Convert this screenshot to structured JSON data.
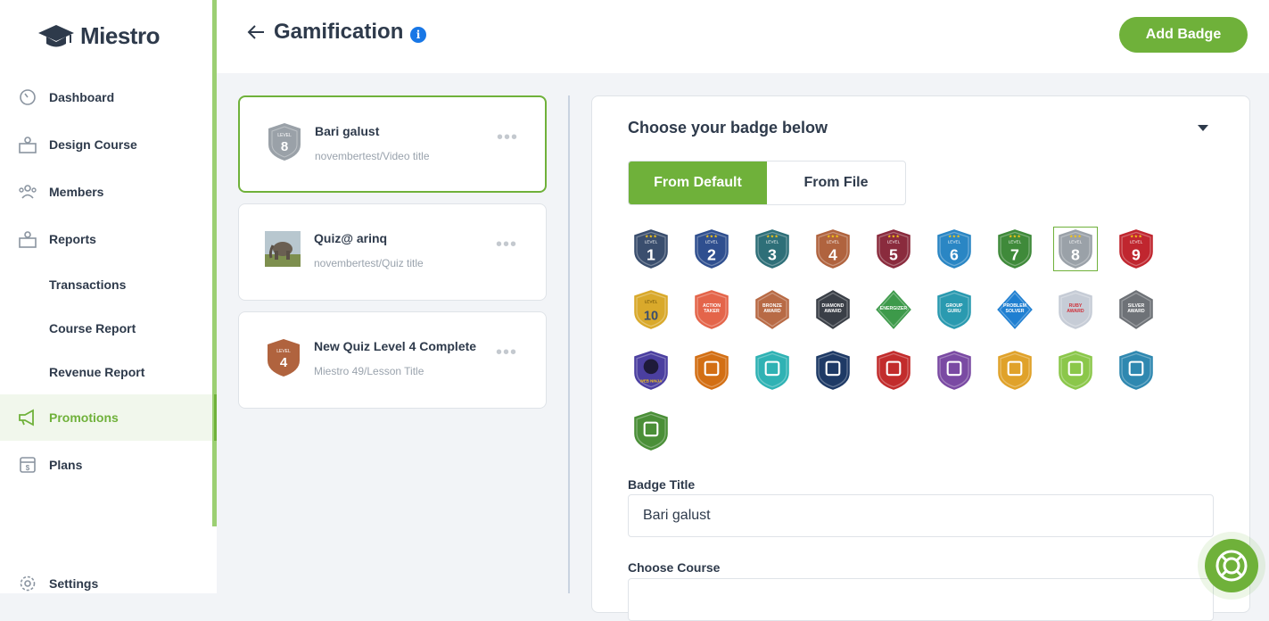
{
  "brand": {
    "name": "Miestro"
  },
  "sidebar": {
    "items": [
      {
        "label": "Dashboard"
      },
      {
        "label": "Design Course"
      },
      {
        "label": "Members"
      },
      {
        "label": "Reports"
      },
      {
        "label": "Transactions"
      },
      {
        "label": "Course Report"
      },
      {
        "label": "Revenue Report"
      },
      {
        "label": "Promotions"
      },
      {
        "label": "Plans"
      },
      {
        "label": "Settings"
      }
    ]
  },
  "header": {
    "title": "Gamification",
    "info_icon": "i",
    "add_button": "Add Badge"
  },
  "badge_list": [
    {
      "title": "Bari galust",
      "subtitle": "novembertest/Video title",
      "level": "8",
      "level_text": "LEVEL",
      "color": "#9aa1a8",
      "dots": "•••"
    },
    {
      "title": "Quiz@ arinq",
      "subtitle": "novembertest/Quiz title",
      "dots": "•••"
    },
    {
      "title": "New Quiz Level 4 Complete",
      "subtitle": "Miestro 49/Lesson Title",
      "level": "4",
      "level_text": "LEVEL",
      "color": "#b0633e",
      "dots": "•••"
    }
  ],
  "editor": {
    "heading": "Choose your badge below",
    "tabs": [
      {
        "label": "From Default",
        "active": true
      },
      {
        "label": "From File",
        "active": false
      }
    ],
    "badge_title_label": "Badge Title",
    "badge_title_value": "Bari galust",
    "course_label": "Choose Course"
  },
  "badge_grid": {
    "levels": [
      {
        "n": "1",
        "color": "#3a4e6e"
      },
      {
        "n": "2",
        "color": "#2f4f8f"
      },
      {
        "n": "3",
        "color": "#2e6f78"
      },
      {
        "n": "4",
        "color": "#b0633e"
      },
      {
        "n": "5",
        "color": "#8a2b3d"
      },
      {
        "n": "6",
        "color": "#2a86c4"
      },
      {
        "n": "7",
        "color": "#3f8a3a"
      },
      {
        "n": "8",
        "color": "#9aa1a8"
      },
      {
        "n": "9",
        "color": "#c0262f"
      }
    ],
    "level_text": "LEVEL",
    "awards": [
      {
        "text": "10",
        "color": "#d9a92b"
      },
      {
        "text": "ACTION TAKER",
        "color": "#e4654a"
      },
      {
        "text": "BRONZE AWARD",
        "color": "#b86a45"
      },
      {
        "text": "DIAMOND AWARD",
        "color": "#3a3f47"
      },
      {
        "text": "ENERGIZER",
        "color": "#3d9a4a"
      },
      {
        "text": "GROUP GURU",
        "color": "#2a9ab0"
      },
      {
        "text": "PROBLEM SOLVER",
        "color": "#1f7fd1"
      },
      {
        "text": "RUBY AWARD",
        "color": "#c6ccd6"
      },
      {
        "text": "SILVER AWARD",
        "color": "#6e7277"
      }
    ],
    "icons": [
      {
        "text": "WEB NINJA",
        "color": "#4b3fa0"
      },
      {
        "text": "",
        "color": "#d36f14"
      },
      {
        "text": "",
        "color": "#2fb2b4"
      },
      {
        "text": "",
        "color": "#1e3a66"
      },
      {
        "text": "",
        "color": "#c22c2c"
      },
      {
        "text": "",
        "color": "#7a4aa3"
      },
      {
        "text": "",
        "color": "#e0a22a"
      },
      {
        "text": "",
        "color": "#8bc74a"
      },
      {
        "text": "",
        "color": "#2f88b0"
      },
      {
        "text": "",
        "color": "#4a8f37"
      }
    ]
  },
  "colors": {
    "accent": "#6fb13a",
    "info": "#1877e6",
    "text": "#2e3a4b"
  }
}
